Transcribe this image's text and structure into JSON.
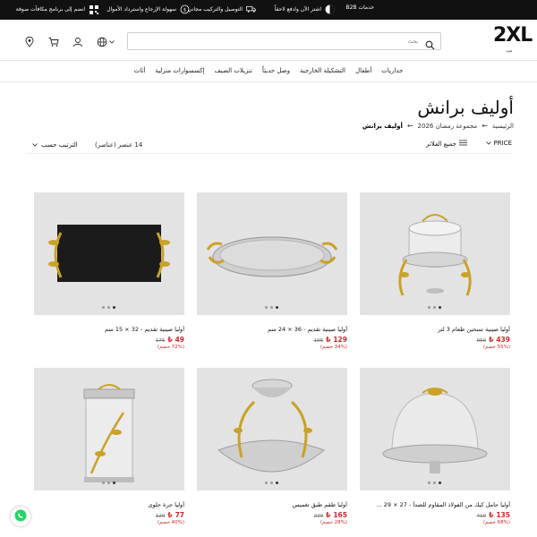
{
  "topbar": {
    "promos": [
      {
        "label": "خدمات B2B",
        "icon": "briefcase-icon"
      },
      {
        "label": "اشتر الآن وادفع لاحقاً",
        "icon": "split-pay-icon"
      },
      {
        "label": "التوصيل والتركيب مجاني",
        "icon": "delivery-truck-icon"
      },
      {
        "label": "سهولة الإرجاع واسترداد الأموال",
        "icon": "return-icon"
      },
      {
        "label": "انضم إلى برنامج مكافآت صوفة",
        "icon": "qr-code-icon"
      }
    ]
  },
  "header": {
    "logo_text": "2XL",
    "logo_sub": "هوم",
    "search_placeholder": "بحث"
  },
  "nav": {
    "items": [
      "أثاث",
      "إكسسوارات منزلية",
      "تنزيلات الصيف",
      "وصل حديثاً",
      "التشكيلة الخارجية",
      "أطفال",
      "جداريات"
    ]
  },
  "page": {
    "title": "أوليف برانش",
    "breadcrumb": {
      "home": "الرئيسية",
      "collection": "مجموعة رمضان 2026",
      "current": "أوليف برانش",
      "separator": "←"
    }
  },
  "filters": {
    "price_label": "PRICE",
    "all_filters": "جميع الفلاتر",
    "count": "14 عنصر (عناصر)",
    "sort": "الترتيب حسب"
  },
  "products": [
    {
      "name": "أوليا صينية تسخين طعام 3 لتر",
      "price": "439",
      "old": "969",
      "discount": "(55% خصم)",
      "image": "food-warmer"
    },
    {
      "name": "أوليا صينية تقديم - 36 × 24 سم",
      "price": "129",
      "old": "195",
      "discount": "(34% خصم)",
      "image": "oval-tray"
    },
    {
      "name": "أوليا صينية تقديم - 32 × 15 سم",
      "price": "49",
      "old": "175",
      "discount": "(72% خصم)",
      "image": "black-tray"
    },
    {
      "name": "أوليا حامل كيك من الفولاذ المقاوم للصدأ - 27 × 29 ...",
      "price": "135",
      "old": "419",
      "discount": "(68% خصم)",
      "image": "cake-stand"
    },
    {
      "name": "أوليا طقم طبق تغميس",
      "price": "165",
      "old": "229",
      "discount": "(28% خصم)",
      "image": "dip-set"
    },
    {
      "name": "أوليا جرة حلوى",
      "price": "77",
      "old": "129",
      "discount": "(40% خصم)",
      "image": "candy-jar"
    }
  ],
  "currency_symbol": "₺",
  "colors": {
    "sale": "#d3262b",
    "gold": "#c9a227",
    "dark": "#111111"
  }
}
